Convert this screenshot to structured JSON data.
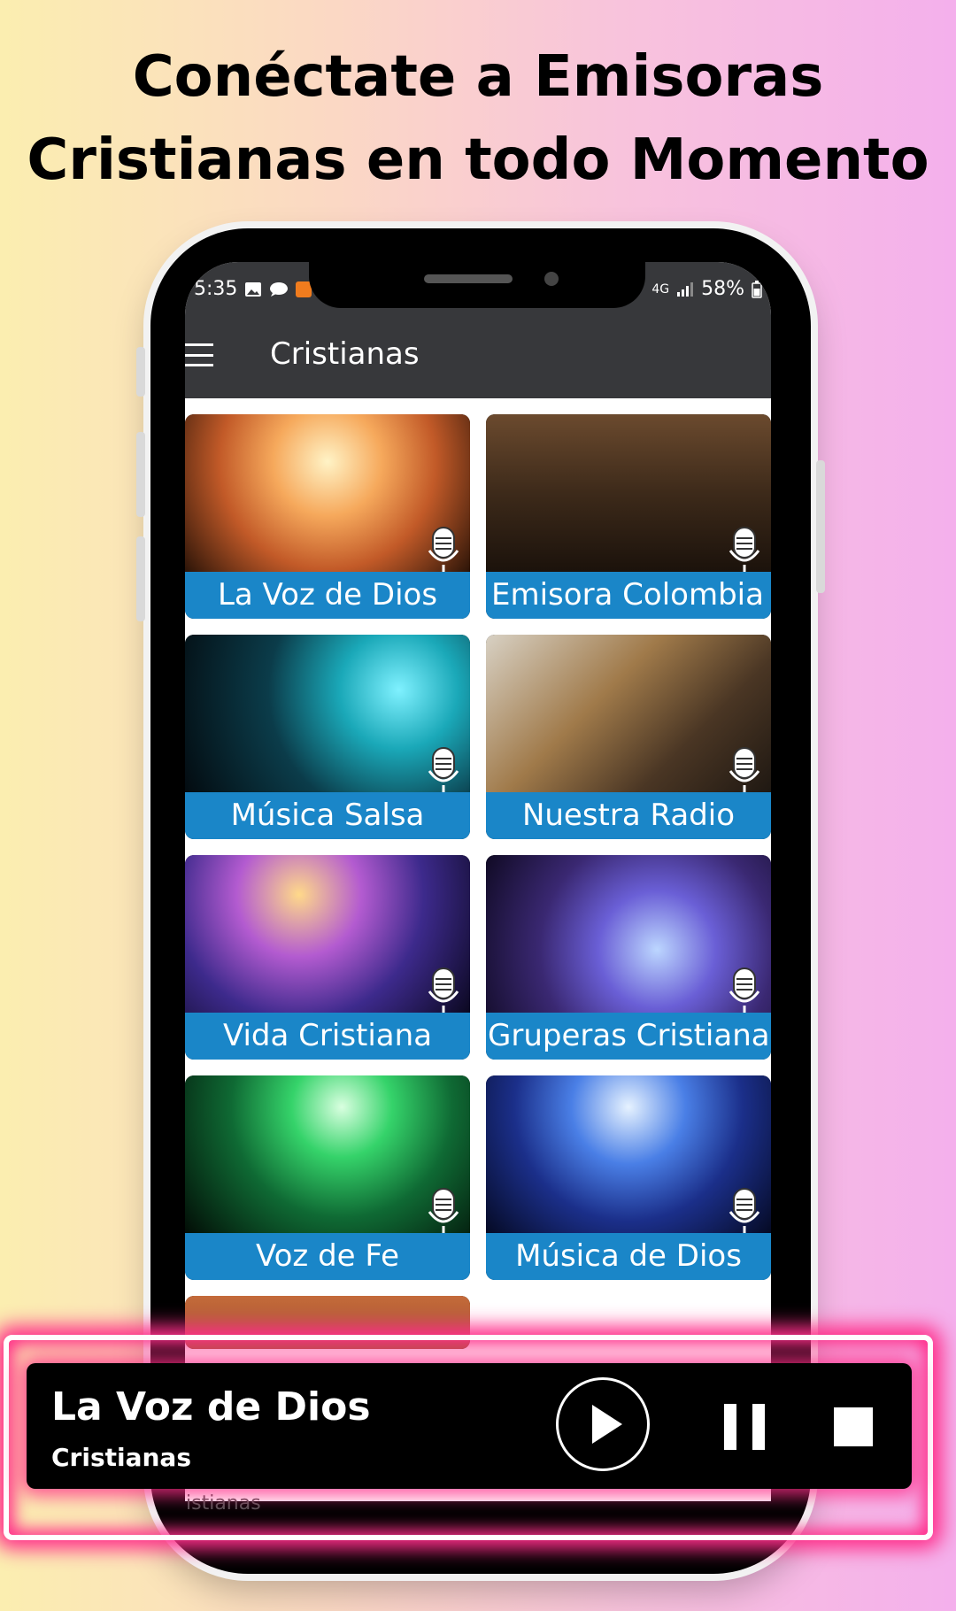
{
  "headline": {
    "line1": "Conéctate a Emisoras",
    "line2": "Cristianas en todo Momento"
  },
  "status_bar": {
    "time": "5:35",
    "battery": "58%",
    "network": "4G"
  },
  "app_bar": {
    "title": "Cristianas",
    "menu_icon": "hamburger-menu-icon"
  },
  "stations": [
    {
      "label": "La Voz de Dios",
      "icon": "microphone-icon"
    },
    {
      "label": "Emisora Colombia",
      "icon": "microphone-icon"
    },
    {
      "label": "Música Salsa",
      "icon": "microphone-icon"
    },
    {
      "label": "Nuestra Radio",
      "icon": "microphone-icon"
    },
    {
      "label": "Vida Cristiana",
      "icon": "microphone-icon"
    },
    {
      "label": "Gruperas Cristianas",
      "icon": "microphone-icon"
    },
    {
      "label": "Voz de Fe",
      "icon": "microphone-icon"
    },
    {
      "label": "Música de Dios",
      "icon": "microphone-icon"
    }
  ],
  "player": {
    "title": "La Voz de Dios",
    "subtitle": "Cristianas",
    "under_text": "istianas",
    "controls": [
      "play-icon",
      "pause-icon",
      "stop-icon"
    ]
  },
  "colors": {
    "accent_blue": "#1a86c8",
    "appbar": "#37383b",
    "neon_pink": "#ff2e8a"
  }
}
